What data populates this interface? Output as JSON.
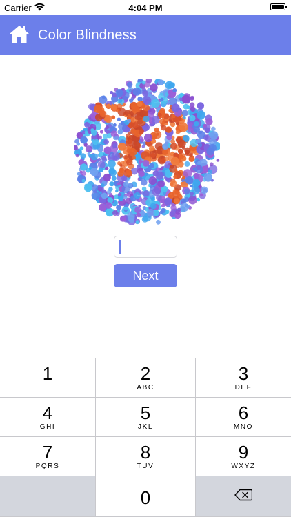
{
  "status_bar": {
    "carrier": "Carrier",
    "time": "4:04 PM",
    "wifi_icon": "wifi-icon",
    "battery_icon": "battery-icon"
  },
  "header": {
    "home_icon": "home-icon",
    "title": "Color Blindness",
    "background_color": "#6c7fea"
  },
  "plate": {
    "icon": "ishihara-plate",
    "figure_colors": [
      "#e8642c",
      "#d8502a",
      "#f07a3c",
      "#c9472a"
    ],
    "background_colors": [
      "#5b7fe8",
      "#7b66e0",
      "#9b5fd8",
      "#3fa6ee",
      "#6fa0f0",
      "#8a4fd0",
      "#4ec0f0"
    ]
  },
  "answer": {
    "value": "",
    "placeholder": ""
  },
  "next_button": {
    "label": "Next"
  },
  "keypad": {
    "keys": [
      {
        "digit": "1",
        "letters": ""
      },
      {
        "digit": "2",
        "letters": "ABC"
      },
      {
        "digit": "3",
        "letters": "DEF"
      },
      {
        "digit": "4",
        "letters": "GHI"
      },
      {
        "digit": "5",
        "letters": "JKL"
      },
      {
        "digit": "6",
        "letters": "MNO"
      },
      {
        "digit": "7",
        "letters": "PQRS"
      },
      {
        "digit": "8",
        "letters": "TUV"
      },
      {
        "digit": "9",
        "letters": "WXYZ"
      }
    ],
    "zero": {
      "digit": "0"
    },
    "delete_icon": "backspace-icon"
  }
}
